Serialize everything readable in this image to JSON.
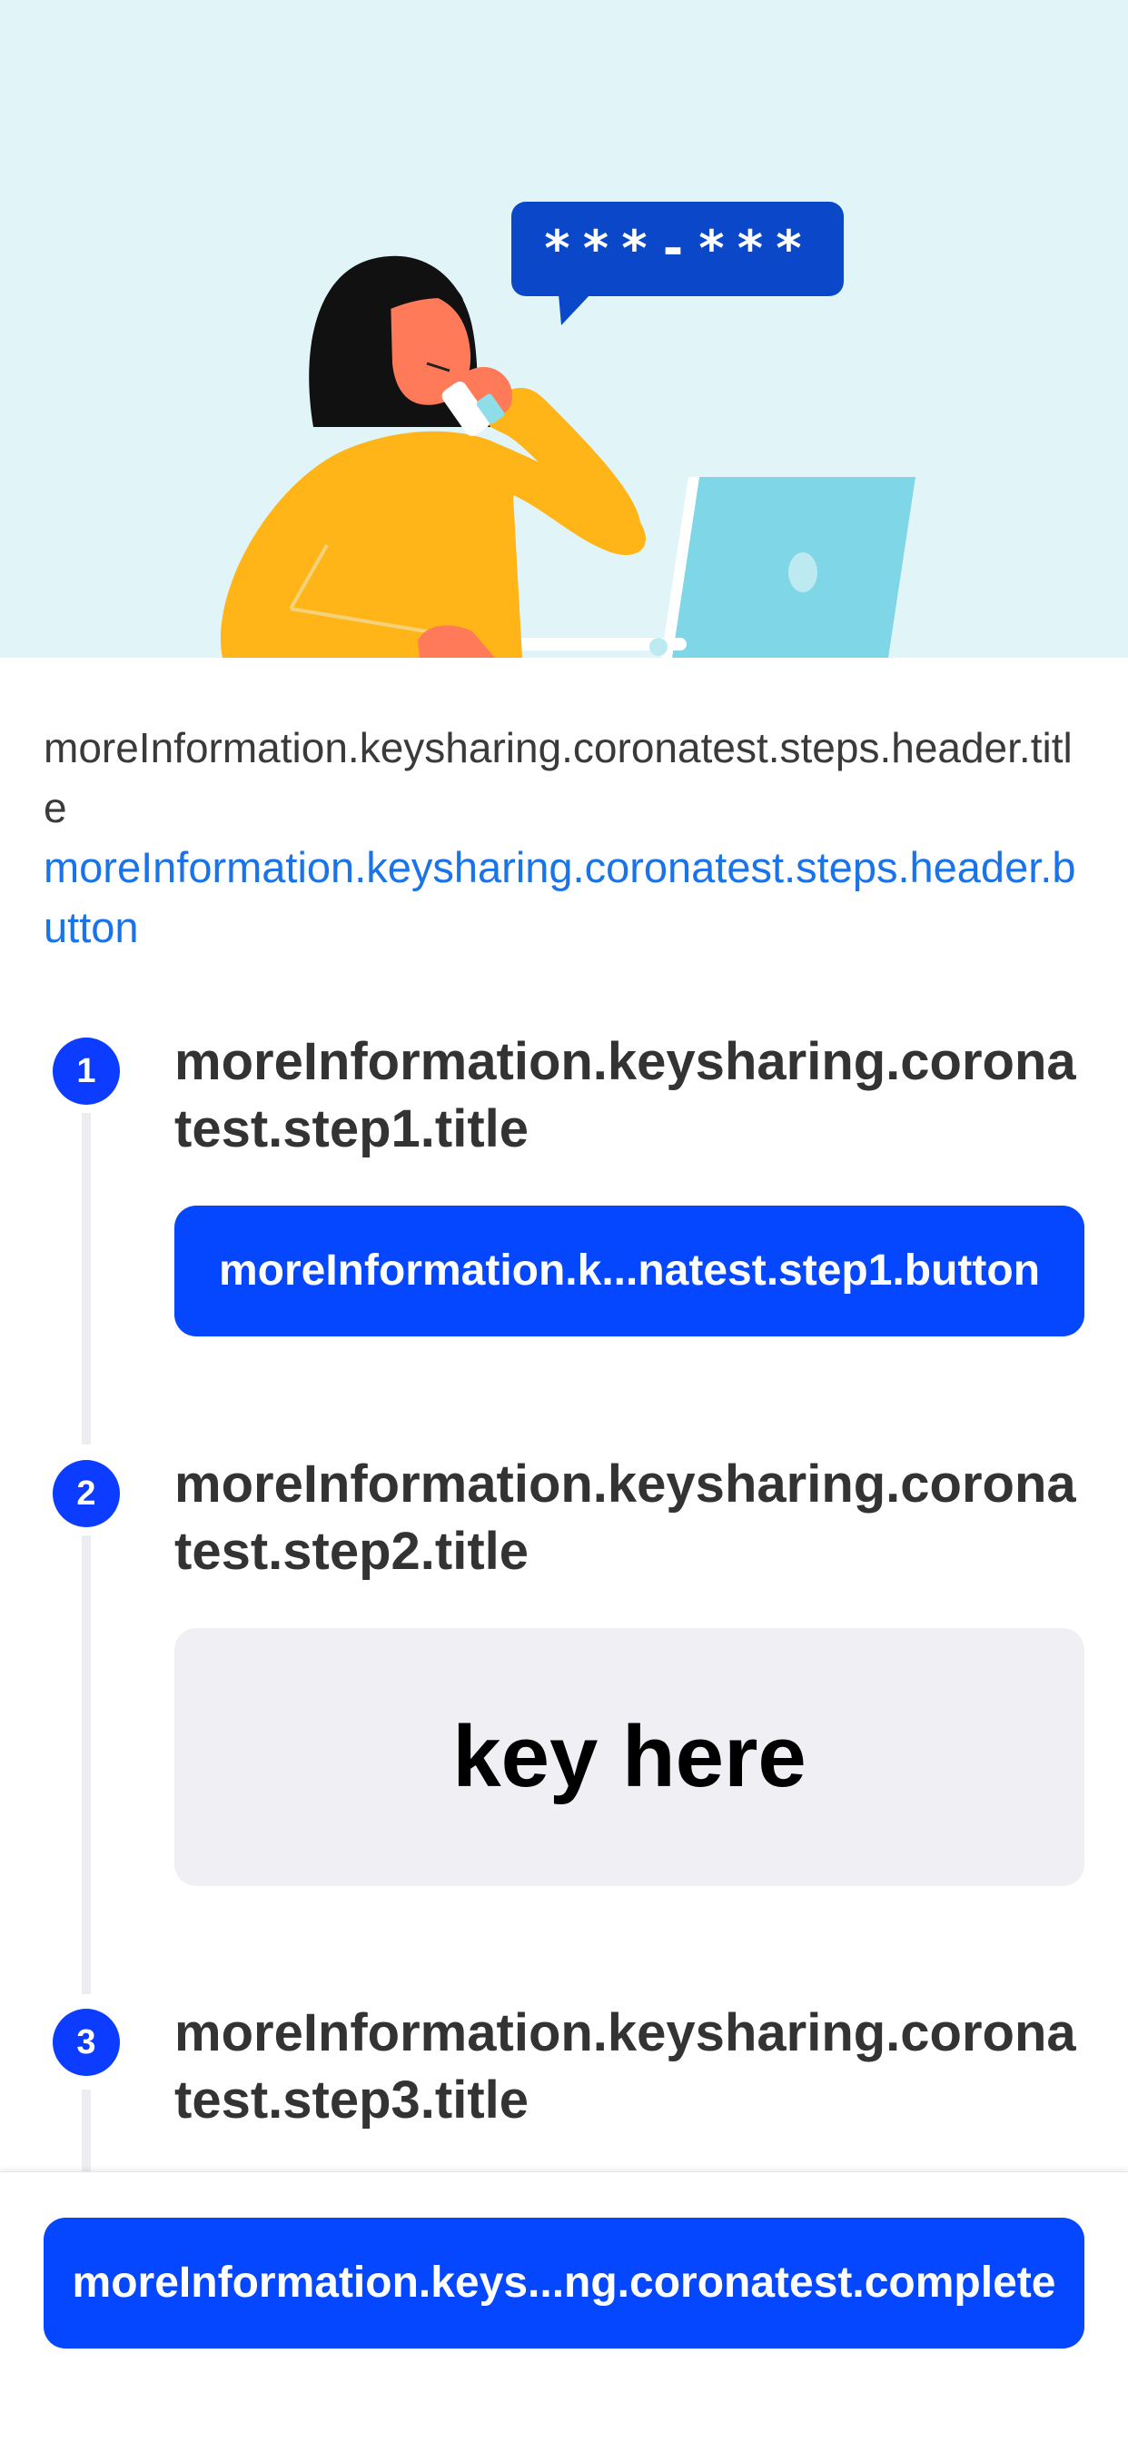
{
  "hero": {
    "bubble_text": "***-***"
  },
  "header": {
    "title": "moreInformation.keysharing.coronatest.steps.header.title",
    "button": "moreInformation.keysharing.coronatest.steps.header.button"
  },
  "steps": [
    {
      "number": "1",
      "title": "moreInformation.keysharing.coronatest.step1.title",
      "button": "moreInformation.k...natest.step1.button"
    },
    {
      "number": "2",
      "title": "moreInformation.keysharing.coronatest.step2.title",
      "key": "key here"
    },
    {
      "number": "3",
      "title": "moreInformation.keysharing.coronatest.step3.title"
    }
  ],
  "footer": {
    "complete_button": "moreInformation.keys...ng.coronatest.complete"
  },
  "colors": {
    "accent": "#0546ff",
    "link": "#1a73e8",
    "hero_background": "#e1f5f8"
  }
}
